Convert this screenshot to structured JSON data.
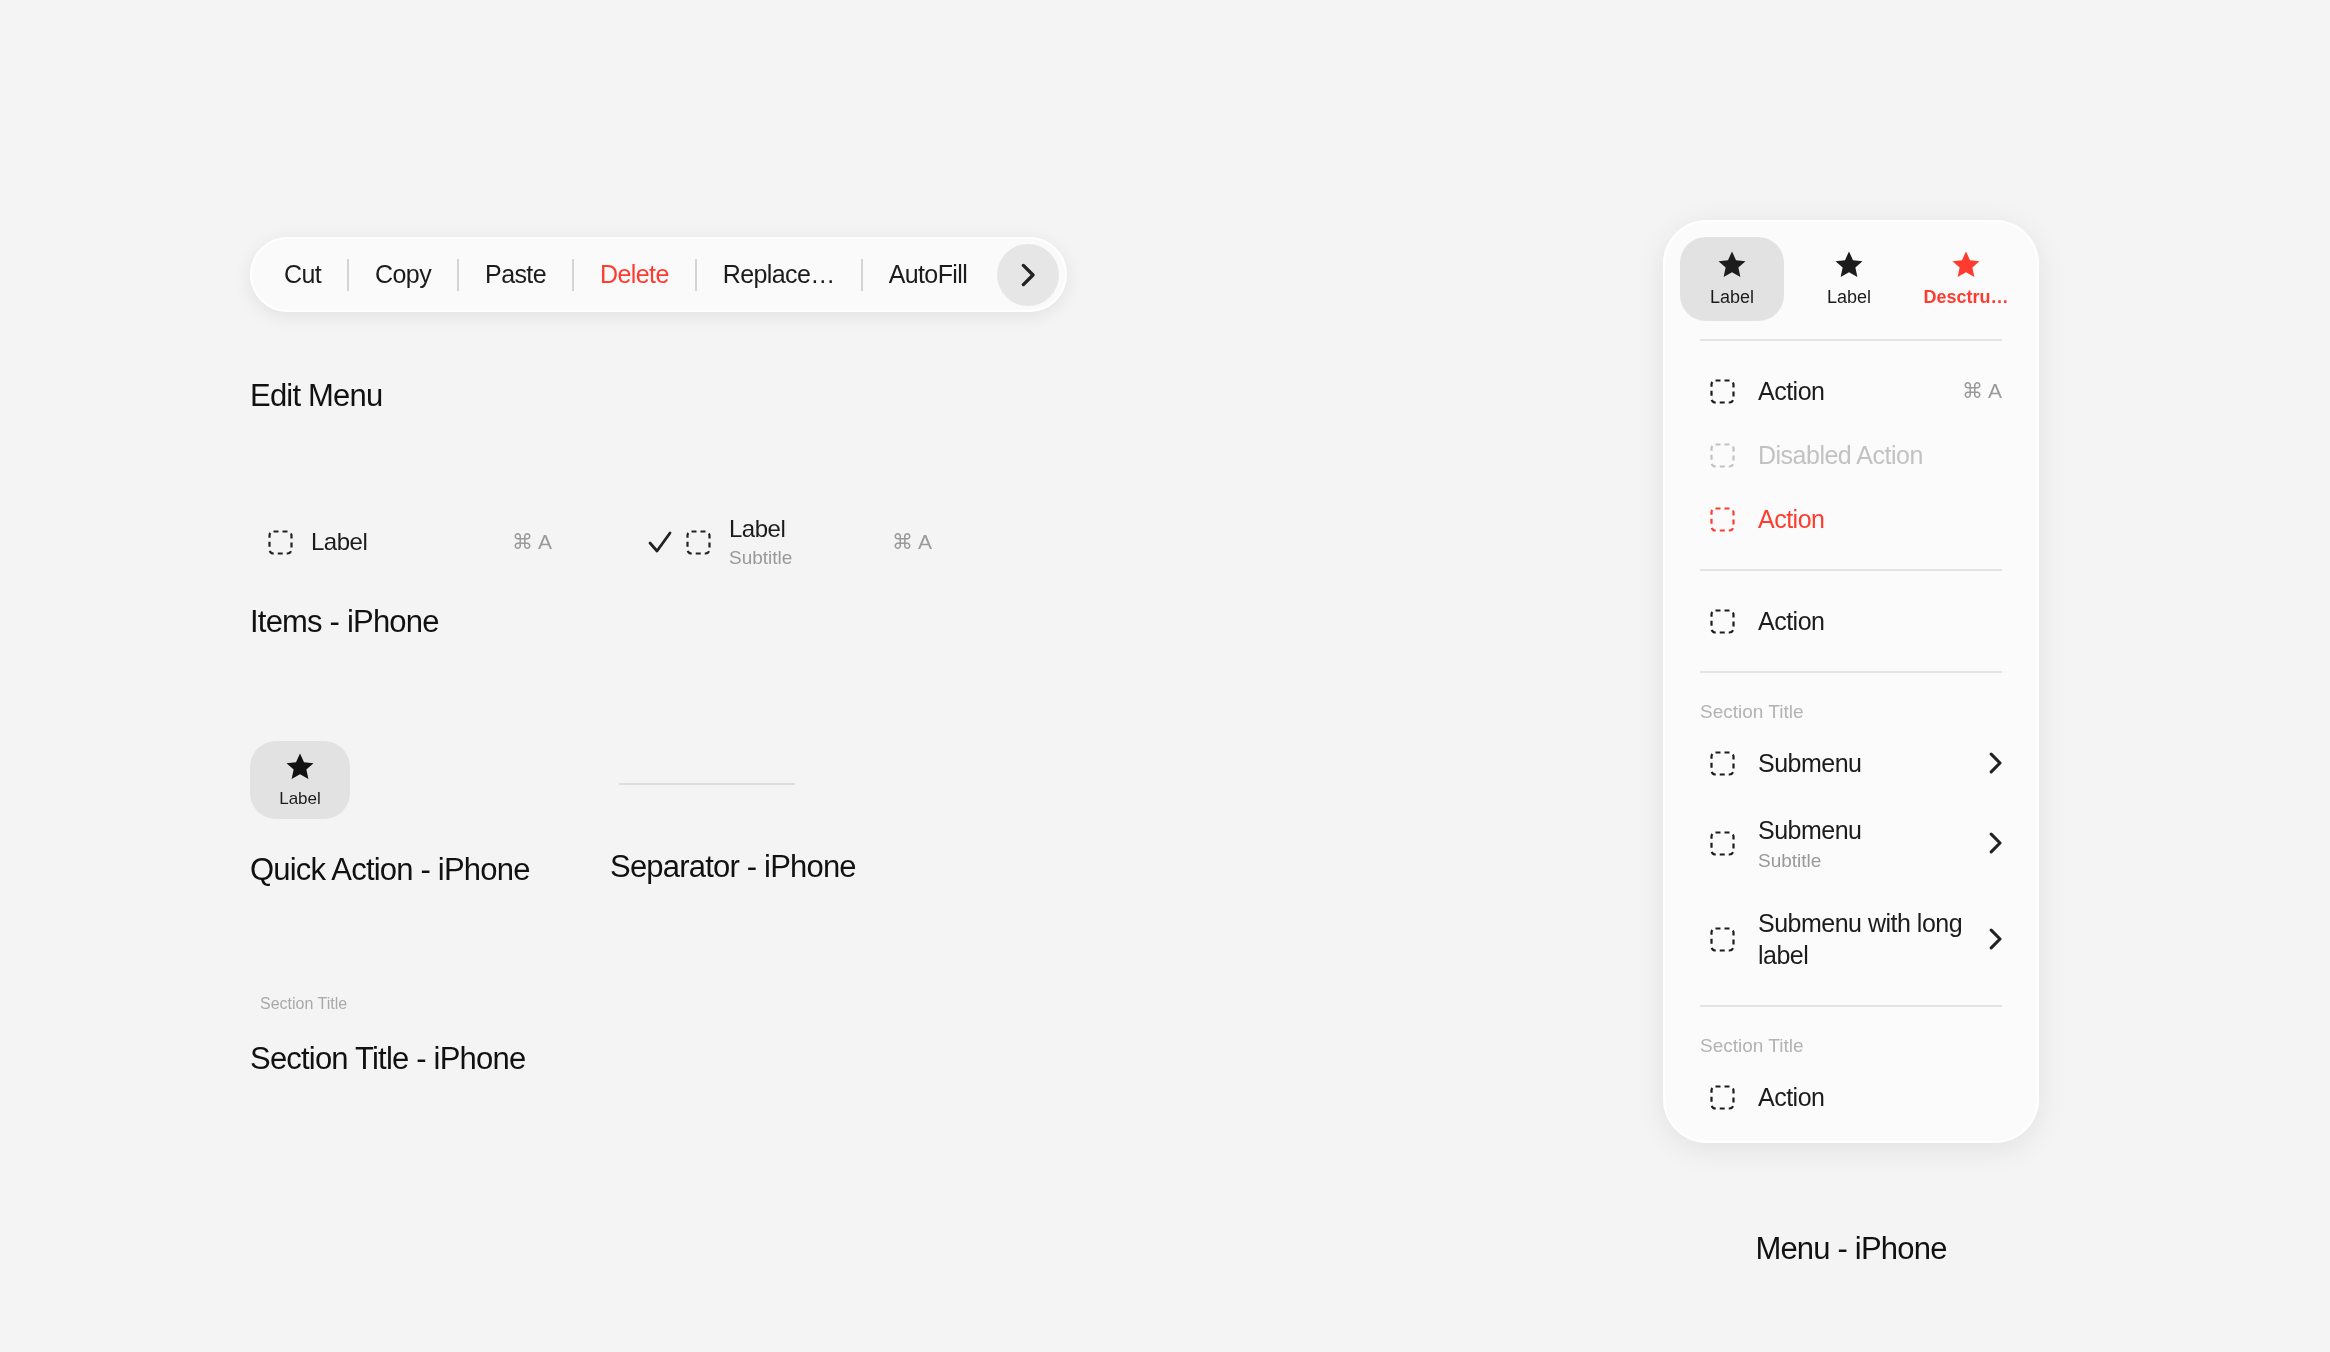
{
  "edit_menu": {
    "items": [
      {
        "label": "Cut",
        "kind": "normal"
      },
      {
        "label": "Copy",
        "kind": "normal"
      },
      {
        "label": "Paste",
        "kind": "normal"
      },
      {
        "label": "Delete",
        "kind": "destructive"
      },
      {
        "label": "Replace…",
        "kind": "normal"
      },
      {
        "label": "AutoFill",
        "kind": "normal"
      }
    ],
    "caption": "Edit Menu"
  },
  "items_iphone": {
    "items": [
      {
        "label": "Label",
        "shortcut": "⌘ A",
        "checked": false
      },
      {
        "label": "Label",
        "subtitle": "Subtitle",
        "shortcut": "⌘ A",
        "checked": true
      }
    ],
    "caption": "Items - iPhone"
  },
  "quick_action": {
    "label": "Label",
    "caption": "Quick Action - iPhone"
  },
  "separator": {
    "caption": "Separator - iPhone"
  },
  "section_title": {
    "title": "Section Title",
    "caption": "Section Title - iPhone"
  },
  "menu": {
    "quick_actions": [
      {
        "label": "Label",
        "selected": true,
        "kind": "normal"
      },
      {
        "label": "Label",
        "selected": false,
        "kind": "normal"
      },
      {
        "label": "Desctru…",
        "selected": false,
        "kind": "destructive"
      }
    ],
    "sections": [
      {
        "items": [
          {
            "label": "Action",
            "kind": "normal",
            "shortcut": "⌘ A"
          },
          {
            "label": "Disabled Action",
            "kind": "disabled"
          },
          {
            "label": "Action",
            "kind": "destructive"
          }
        ]
      },
      {
        "items": [
          {
            "label": "Action",
            "kind": "normal"
          }
        ]
      },
      {
        "title": "Section Title",
        "items": [
          {
            "label": "Submenu",
            "kind": "normal",
            "submenu": true
          },
          {
            "label": "Submenu",
            "subtitle": "Subtitle",
            "kind": "normal",
            "submenu": true
          },
          {
            "label": "Submenu with long label",
            "kind": "normal",
            "submenu": true
          }
        ]
      },
      {
        "title": "Section Title",
        "items": [
          {
            "label": "Action",
            "kind": "normal"
          }
        ]
      }
    ],
    "caption": "Menu - iPhone"
  }
}
